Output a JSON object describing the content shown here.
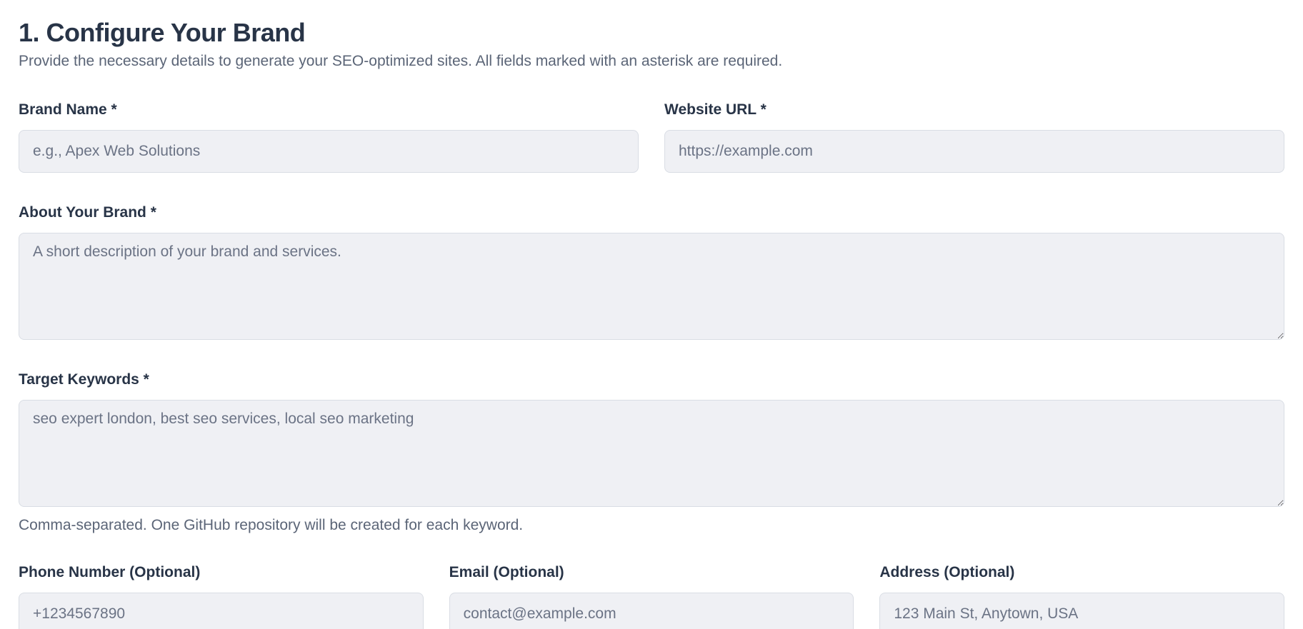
{
  "header": {
    "title": "1. Configure Your Brand",
    "subtitle": "Provide the necessary details to generate your SEO-optimized sites. All fields marked with an asterisk are required."
  },
  "form": {
    "brand_name": {
      "label": "Brand Name *",
      "placeholder": "e.g., Apex Web Solutions"
    },
    "website_url": {
      "label": "Website URL *",
      "placeholder": "https://example.com"
    },
    "about_brand": {
      "label": "About Your Brand *",
      "placeholder": "A short description of your brand and services."
    },
    "target_keywords": {
      "label": "Target Keywords *",
      "placeholder": "seo expert london, best seo services, local seo marketing",
      "hint": "Comma-separated. One GitHub repository will be created for each keyword."
    },
    "phone": {
      "label": "Phone Number (Optional)",
      "placeholder": "+1234567890"
    },
    "email": {
      "label": "Email (Optional)",
      "placeholder": "contact@example.com"
    },
    "address": {
      "label": "Address (Optional)",
      "placeholder": "123 Main St, Anytown, USA"
    }
  },
  "colors": {
    "heading": "#283447",
    "muted_text": "#5b6577",
    "field_background": "#eff0f4",
    "field_border": "#d9dde4"
  }
}
